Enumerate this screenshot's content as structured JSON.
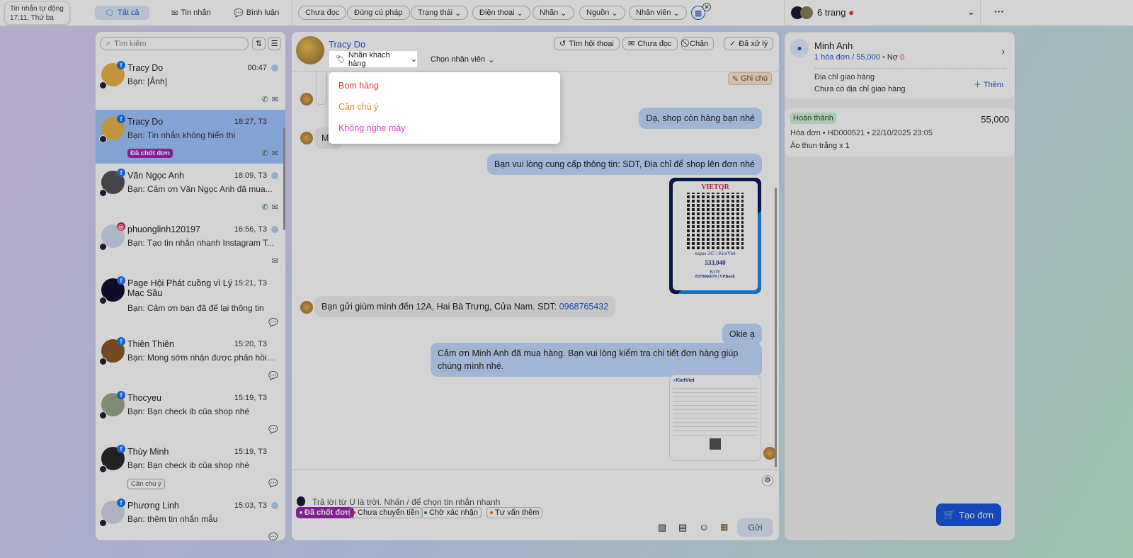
{
  "topbar": {
    "auto_title": "Tin nhắn tự động",
    "auto_time": "17:11, Thứ ba",
    "segments": [
      "Tất cả",
      "Tin nhắn",
      "Bình luận"
    ],
    "filters": [
      "Chưa đọc",
      "Đúng cú pháp",
      "Trạng thái",
      "Điện thoại",
      "Nhãn",
      "Nguồn",
      "Nhân viên"
    ],
    "pages_label": "6 trang"
  },
  "list": {
    "search_placeholder": "Tìm kiếm",
    "items": [
      {
        "name": "Tracy Do",
        "time": "00:47",
        "msg": "Bạn: [Ảnh]",
        "source": "facebook"
      },
      {
        "name": "Tracy Do",
        "time": "18:27, T3",
        "msg": "Bạn: Tin nhắn không hiển thị",
        "tag": "Đã chốt đơn",
        "source": "facebook"
      },
      {
        "name": "Văn Ngọc Anh",
        "time": "18:09, T3",
        "msg": "Bạn: Cảm ơn Văn Ngọc Anh đã mua...",
        "source": "facebook"
      },
      {
        "name": "phuonglinh120197",
        "time": "16:56, T3",
        "msg": "Bạn: Tạo tin nhắn nhanh Instagram T...",
        "source": "instagram"
      },
      {
        "name": "Page Hội Phát cuồng vì Lý Mạc Sầu",
        "time": "15:21, T3",
        "msg": "Bạn: Cảm ơn bạn đã để lại thông tin",
        "source": "facebook"
      },
      {
        "name": "Thiên Thiên",
        "time": "15:20, T3",
        "msg": "Bạn: Mong sớm nhận được phản hồi t...",
        "source": "facebook"
      },
      {
        "name": "Thocyeu",
        "time": "15:19, T3",
        "msg": "Bạn: Bạn check ib của shop nhé",
        "source": "facebook"
      },
      {
        "name": "Thùy Minh",
        "time": "15:19, T3",
        "msg": "Bạn: Bạn check ib của shop nhé",
        "tag": "Cần chú ý",
        "source": "facebook"
      },
      {
        "name": "Phương Linh",
        "time": "15:03, T3",
        "msg": "Bạn: thêm tin nhắn mẫu",
        "source": "facebook"
      }
    ]
  },
  "chat": {
    "name": "Tracy Do",
    "label_btn": "Nhãn khách hàng",
    "staff_btn": "Chọn nhân viên",
    "actions": [
      "Tìm hội thoại",
      "Chưa đọc",
      "Chặn",
      "Đã xử lý"
    ],
    "note": "Ghi chú",
    "label_options": [
      {
        "label": "Bom hàng",
        "color": "#e53935"
      },
      {
        "label": "Cần chú ý",
        "color": "#d9822b"
      },
      {
        "label": "Không nghe máy",
        "color": "#e040c0"
      }
    ],
    "msg_partial": "Mi",
    "messages": {
      "m1": "Dạ, shop còn hàng bạn nhé",
      "m2": "Bạn vui lòng cung cấp thông tin: SDT, Địa chỉ để shop lên đơn nhé",
      "m3_text": "Bạn gửi giùm mình đến 12A, Hai Bà Trưng, Cửa Nam. SDT: ",
      "m3_phone": "0968765432",
      "m4": "Okie ạ",
      "m5": "Cảm ơn Minh Anh đã mua hàng. Bạn vui lòng kiểm tra chi tiết đơn hàng giúp chúng mình nhé."
    },
    "qr": {
      "brand": "VIETQR",
      "napas": "napas 247",
      "kiot": "KiotViet",
      "amount": "533,040",
      "holder": "KOV",
      "account": "8379666679 | VPBank"
    },
    "invoice_brand": "KiotViet",
    "quick_tags": [
      {
        "label": "Đã chốt đơn",
        "color": "#9c27b0"
      },
      {
        "label": "Chưa chuyển tiền",
        "color": "#e53935"
      },
      {
        "label": "Chờ xác nhận",
        "color": "#2e7d32"
      },
      {
        "label": "Tư vấn thêm",
        "color": "#ef6c00"
      }
    ],
    "composer_placeholder": "Trả lời từ U là trời. Nhấn / để chọn tin nhắn nhanh",
    "send": "Gửi"
  },
  "customer": {
    "name": "Minh Anh",
    "orders": "1 hóa đơn",
    "total": "55,000",
    "debt_label": "Nợ",
    "debt": "0",
    "address_label": "Địa chỉ giao hàng",
    "address_value": "Chưa có địa chỉ giao hàng",
    "add": "Thêm"
  },
  "order": {
    "status": "Hoàn thành",
    "amount": "55,000",
    "meta": "Hóa đơn • HD000521 • 22/10/2025 23:05",
    "items": "Áo thun trắng x 1"
  },
  "create_order": "Tạo đơn"
}
